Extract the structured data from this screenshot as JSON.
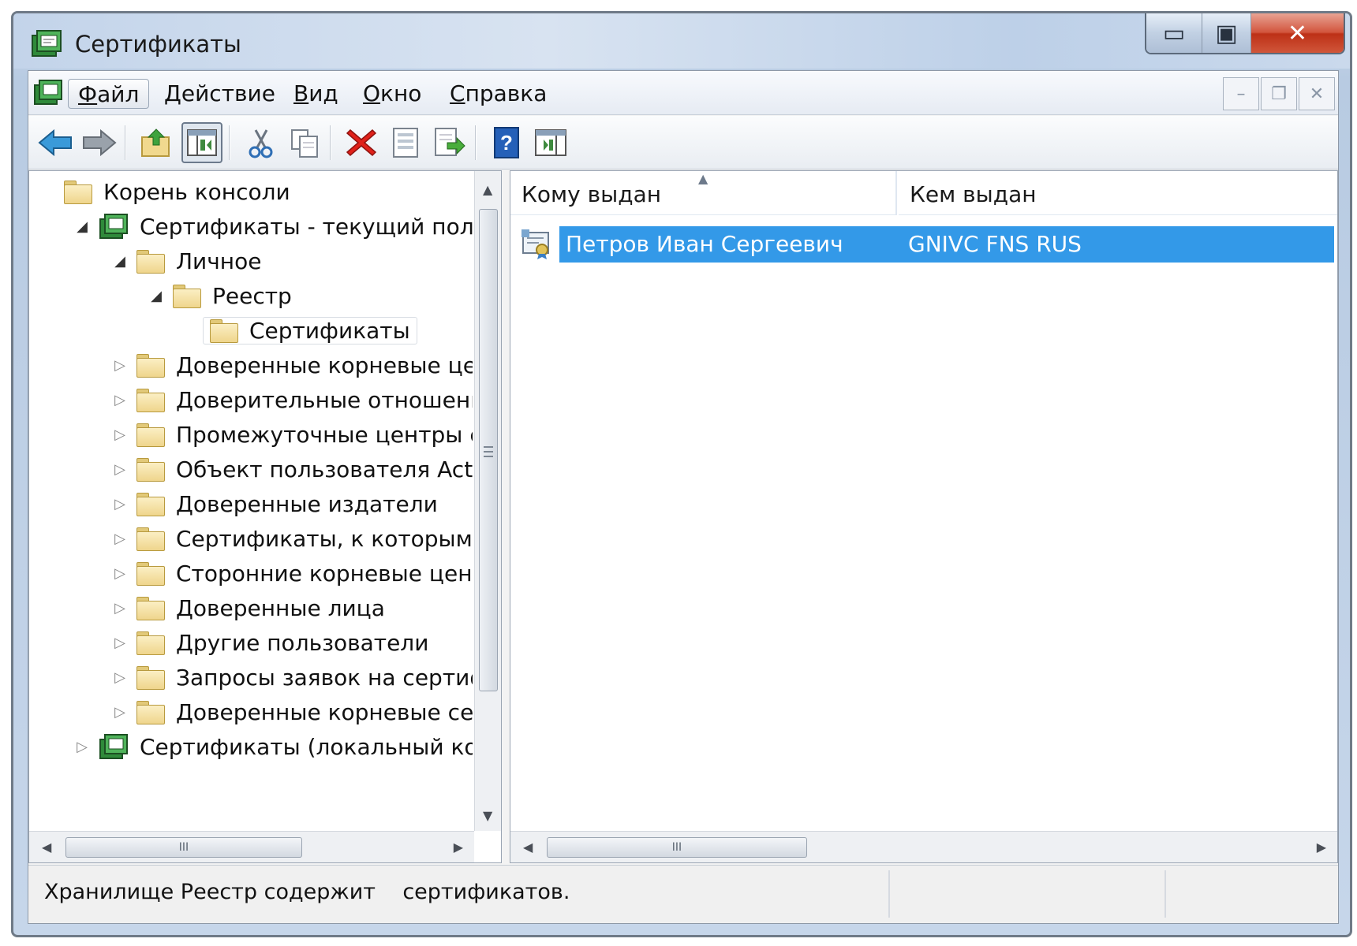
{
  "window": {
    "title": "Сертификаты",
    "caption_buttons": {
      "minimize": "▭",
      "maximize": "▣",
      "close": "✕"
    }
  },
  "menubar": {
    "items": [
      {
        "label": "Файл",
        "accel": "Ф",
        "rest": "айл",
        "active": true
      },
      {
        "label": "Действие",
        "accel": "Д",
        "rest": "ействие"
      },
      {
        "label": "Вид",
        "accel": "В",
        "rest": "ид"
      },
      {
        "label": "Окно",
        "accel": "О",
        "rest": "кно"
      },
      {
        "label": "Справка",
        "accel": "С",
        "rest": "правка"
      }
    ],
    "mdi_buttons": {
      "minimize": "–",
      "restore": "❐",
      "close": "✕"
    }
  },
  "toolbar": {
    "buttons": [
      "back-icon",
      "forward-icon",
      "up-icon",
      "show-hide-tree-icon",
      "cut-icon",
      "copy-icon",
      "delete-icon",
      "properties-icon",
      "export-icon",
      "help-icon",
      "show-hide-action-pane-icon"
    ]
  },
  "tree": {
    "nodes": [
      {
        "label": "Корень консоли",
        "level": 0,
        "twisty": "",
        "icon": "folder"
      },
      {
        "label": "Сертификаты - текущий пользов",
        "level": 1,
        "twisty": "◢",
        "icon": "snapin"
      },
      {
        "label": "Личное",
        "level": 2,
        "twisty": "◢",
        "icon": "folder"
      },
      {
        "label": "Реестр",
        "level": 3,
        "twisty": "◢",
        "icon": "folder"
      },
      {
        "label": "Сертификаты",
        "level": 4,
        "twisty": "",
        "icon": "folder",
        "selected": true
      },
      {
        "label": "Доверенные корневые центры",
        "level": 2,
        "twisty": "▷",
        "icon": "folder"
      },
      {
        "label": "Доверительные отношения в",
        "level": 2,
        "twisty": "▷",
        "icon": "folder"
      },
      {
        "label": "Промежуточные центры серт",
        "level": 2,
        "twisty": "▷",
        "icon": "folder"
      },
      {
        "label": "Объект пользователя Active D",
        "level": 2,
        "twisty": "▷",
        "icon": "folder"
      },
      {
        "label": "Доверенные издатели",
        "level": 2,
        "twisty": "▷",
        "icon": "folder"
      },
      {
        "label": "Сертификаты, к которым нет",
        "level": 2,
        "twisty": "▷",
        "icon": "folder"
      },
      {
        "label": "Сторонние корневые центры",
        "level": 2,
        "twisty": "▷",
        "icon": "folder"
      },
      {
        "label": "Доверенные лица",
        "level": 2,
        "twisty": "▷",
        "icon": "folder"
      },
      {
        "label": "Другие пользователи",
        "level": 2,
        "twisty": "▷",
        "icon": "folder"
      },
      {
        "label": "Запросы заявок на сертифика",
        "level": 2,
        "twisty": "▷",
        "icon": "folder"
      },
      {
        "label": "Доверенные корневые сертис",
        "level": 2,
        "twisty": "▷",
        "icon": "folder"
      },
      {
        "label": "Сертификаты (локальный компь",
        "level": 1,
        "twisty": "▷",
        "icon": "snapin"
      }
    ]
  },
  "list": {
    "columns": [
      "Кому выдан",
      "Кем выдан"
    ],
    "rows": [
      {
        "issued_to": "Петров Иван Сергеевич",
        "issued_by": "GNIVC FNS RUS",
        "selected": true
      }
    ]
  },
  "status": {
    "text": "Хранилище Реестр содержит    сертификатов."
  },
  "scrollbars": {
    "thumb_grip": "III"
  }
}
